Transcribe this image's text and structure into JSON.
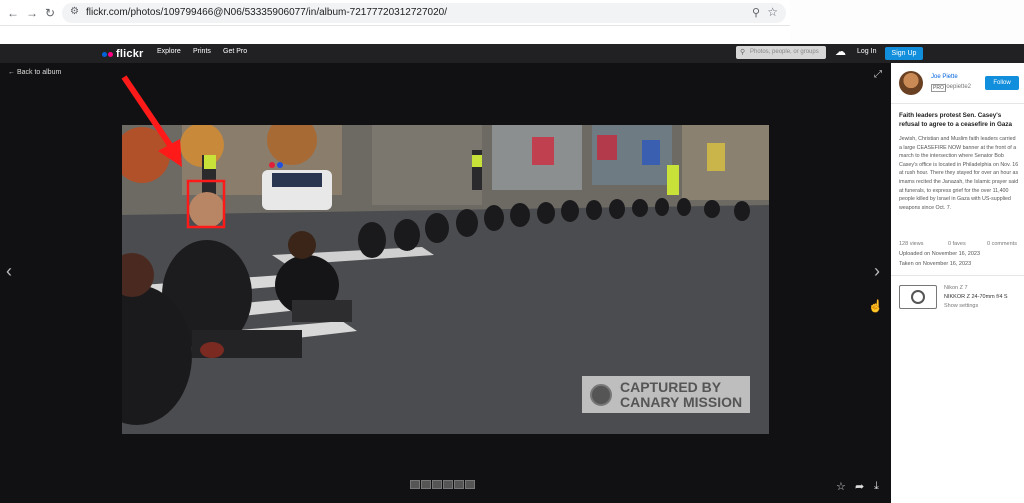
{
  "browser": {
    "url": "flickr.com/photos/109799466@N06/53335906077/in/album-72177720312727020/",
    "back_icon": "←",
    "forward_icon": "→",
    "reload_icon": "↻",
    "tune_icon": "⚙",
    "zoom_icon": "⚲",
    "star_icon": "☆"
  },
  "header": {
    "logo": "flickr",
    "nav": [
      "Explore",
      "Prints",
      "Get Pro"
    ],
    "search_placeholder": "Photos, people, or groups",
    "login": "Log In",
    "signup": "Sign Up",
    "upload_icon": "☁",
    "search_icon": "⚲"
  },
  "viewer": {
    "back_label": "← Back to album",
    "expand_icon": "⤢",
    "prev_icon": "‹",
    "next_icon": "›",
    "cursor_icon": "☝",
    "fav_icon": "☆",
    "share_icon": "➦",
    "download_icon": "⤓",
    "watermark_line1": "CAPTURED BY",
    "watermark_line2": "CANARY MISSION"
  },
  "sidebar": {
    "owner": "Joe Piette",
    "pro_badge": "PRO",
    "username": "joepiette2",
    "follow": "Follow",
    "title": "Faith leaders protest Sen. Casey's refusal to agree to a ceasefire in Gaza",
    "description": "Jewish, Christian and Muslim faith leaders carried a large CEASEFIRE NOW banner at the front of a march to the intersection where Senator Bob Casey's office is located in Philadelphia on Nov. 16 at rush hour. There they stayed for over an hour as imams recited the Janazah, the Islamic prayer said at funerals, to express grief for the over 11,400 people killed by Israel in Gaza with US-supplied weapons since Oct. 7.",
    "views": "128 views",
    "faves": "0 faves",
    "comments": "0 comments",
    "uploaded": "Uploaded on November 16, 2023",
    "taken": "Taken on November 16, 2023",
    "camera_brand": "Nikon Z 7",
    "lens": "NIKKOR Z 24-70mm f/4 S",
    "show_settings": "Show settings"
  }
}
